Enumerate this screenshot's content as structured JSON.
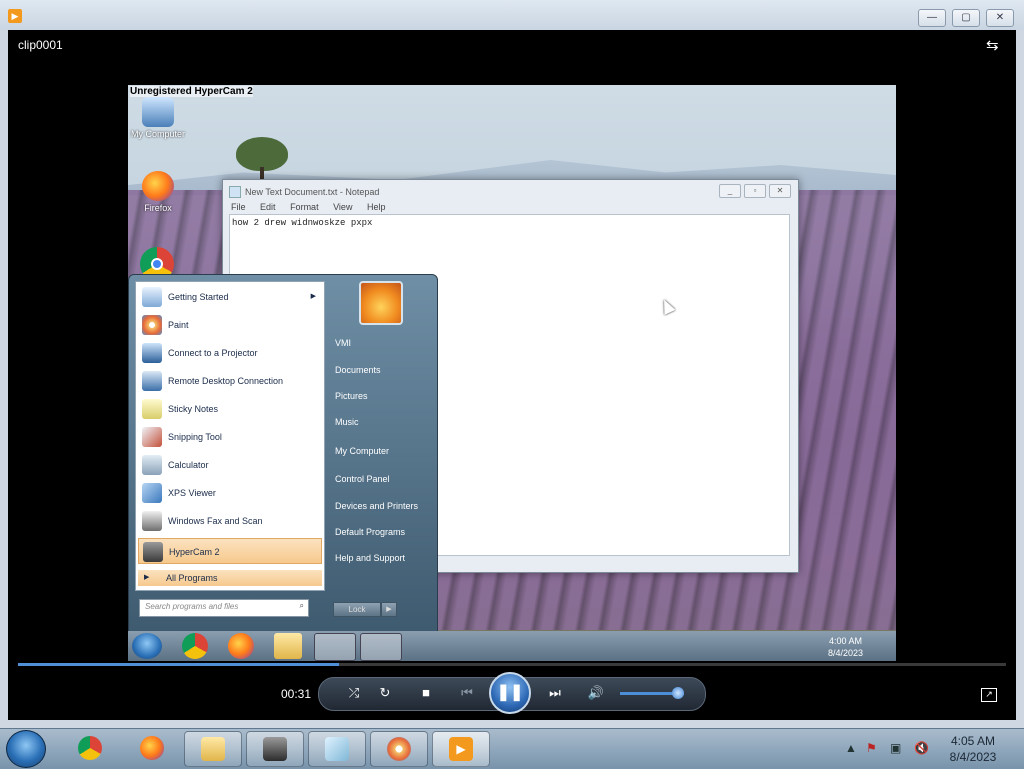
{
  "window": {
    "title": "clip0001",
    "minimize": "—",
    "maximize": "▢",
    "close": "✕"
  },
  "recording": {
    "watermark": "Unregistered HyperCam 2",
    "desktop_icons": [
      {
        "label": "My Computer",
        "icon": "computer-icon"
      },
      {
        "label": "Firefox",
        "icon": "firefox-icon"
      }
    ],
    "notepad": {
      "title": "New Text Document.txt - Notepad",
      "menu": [
        "File",
        "Edit",
        "Format",
        "View",
        "Help"
      ],
      "content": "how 2 drew widnwoskze pxpx"
    },
    "start_menu": {
      "programs": [
        {
          "label": "Getting Started",
          "icon": "getting-started-icon"
        },
        {
          "label": "Paint",
          "icon": "paint-icon"
        },
        {
          "label": "Connect to a Projector",
          "icon": "projector-icon"
        },
        {
          "label": "Remote Desktop Connection",
          "icon": "remote-desktop-icon"
        },
        {
          "label": "Sticky Notes",
          "icon": "sticky-notes-icon"
        },
        {
          "label": "Snipping Tool",
          "icon": "snipping-tool-icon"
        },
        {
          "label": "Calculator",
          "icon": "calculator-icon"
        },
        {
          "label": "XPS Viewer",
          "icon": "xps-viewer-icon"
        },
        {
          "label": "Windows Fax and Scan",
          "icon": "fax-scan-icon"
        },
        {
          "label": "HyperCam 2",
          "icon": "hypercam-icon"
        }
      ],
      "all_programs": "All Programs",
      "search_placeholder": "Search programs and files",
      "right_items": [
        "VMI",
        "Documents",
        "Pictures",
        "Music",
        "My Computer",
        "Control Panel",
        "Devices and Printers",
        "Default Programs",
        "Help and Support"
      ],
      "lock": "Lock"
    },
    "clock": {
      "time": "4:00 AM",
      "date": "8/4/2023"
    }
  },
  "playback": {
    "elapsed": "00:31",
    "progress": 0.325,
    "volume": 0.9
  },
  "taskbar": {
    "clock_time": "4:05 AM",
    "clock_date": "8/4/2023"
  },
  "colors": {
    "accent": "#2d68b5",
    "titlebar": "#dfe8f1"
  }
}
